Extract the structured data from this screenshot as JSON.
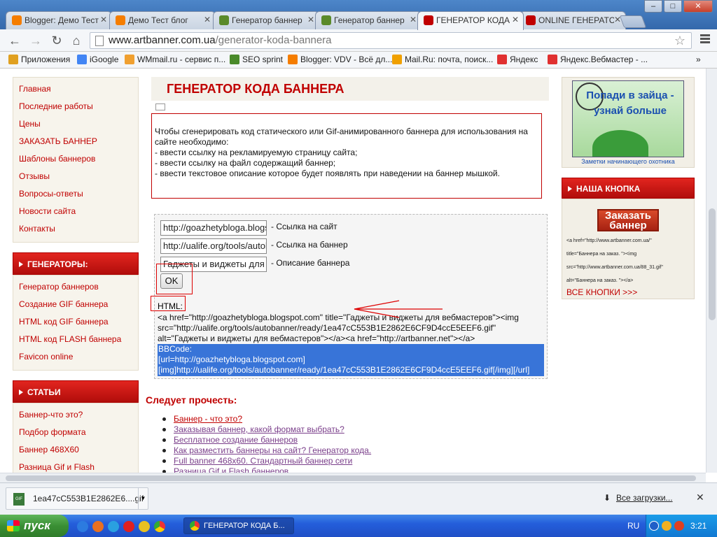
{
  "window": {
    "tabs": [
      {
        "label": "Blogger: Демо Тест",
        "icon_color": "#f57d00"
      },
      {
        "label": "Демо Тест блог",
        "icon_color": "#f57d00"
      },
      {
        "label": "Генератор баннер",
        "icon_color": "#5a8a2a"
      },
      {
        "label": "Генератор баннер",
        "icon_color": "#5a8a2a"
      },
      {
        "label": "ГЕНЕРАТОР КОДА",
        "icon_color": "#c00000",
        "active": true
      },
      {
        "label": "ONLINE ГЕНЕРАТС",
        "icon_color": "#c00000"
      }
    ],
    "buttons": {
      "minimize": "–",
      "maximize": "□",
      "close": "✕"
    }
  },
  "toolbar": {
    "url_host": "www.artbanner.com.ua",
    "url_path": "/generator-koda-bannera"
  },
  "bookmarks": [
    {
      "label": "Приложения",
      "icon_color": "#e0a020"
    },
    {
      "label": "iGoogle",
      "icon_color": "#4285f4"
    },
    {
      "label": "WMmail.ru - сервис п...",
      "icon_color": "#f0a030"
    },
    {
      "label": "SEO sprint",
      "icon_color": "#4a8a2a"
    },
    {
      "label": "Blogger: VDV - Всё дл...",
      "icon_color": "#f57d00"
    },
    {
      "label": "Mail.Ru: почта, поиск...",
      "icon_color": "#f0a000"
    },
    {
      "label": "Яндекс",
      "icon_color": "#e03030"
    },
    {
      "label": "Яндекс.Вебмастер - ...",
      "icon_color": "#e03030"
    }
  ],
  "left_menu": {
    "main": [
      "Главная",
      "Последние работы",
      "Цены",
      "ЗАКАЗАТЬ БАННЕР",
      "Шаблоны баннеров",
      "Отзывы",
      "Вопросы-ответы",
      "Новости сайта",
      "Контакты"
    ],
    "generators_title": "ГЕНЕРАТОРЫ:",
    "generators": [
      "Генератор баннеров",
      "Создание GIF баннера",
      "HTML код GIF баннера",
      "HTML код FLASH баннера",
      "Favicon online"
    ],
    "articles_title": "СТАТЬИ",
    "articles": [
      "Баннер-что это?",
      "Подбор формата",
      "Баннер 468Х60",
      "Разница Gif и Flash"
    ]
  },
  "main": {
    "title": "ГЕНЕРАТОР КОДА БАННЕРА",
    "info": [
      "Чтобы сгенерировать код статического или Gif-анимированного баннера для использования на сайте необходимо:",
      "- ввести ссылку на рекламируемую страницу сайта;",
      "- ввести ссылку на файл содержащий баннер;",
      "- ввести текстовое описание которое будет появлять при наведении на баннер мышкой."
    ],
    "fields": [
      {
        "value": "http://goazhetybloga.blogs",
        "label": "- Ссылка на сайт"
      },
      {
        "value": "http://ualife.org/tools/autol",
        "label": "- Ссылка на баннер"
      },
      {
        "value": "Гаджеты и виджеты для",
        "label": "- Описание баннера"
      }
    ],
    "ok_label": "OK",
    "html_label": "HTML:",
    "html_code": [
      "<a href=\"http://goazhetybloga.blogspot.com\" title=\"Гаджеты и виджеты для вебмастеров\"><img",
      "src=\"http://ualife.org/tools/autobanner/ready/1ea47cC553B1E2862E6CF9D4ccE5EEF6.gif\"",
      "alt=\"Гаджеты и виджеты для вебмастеров\"></a><a href=\"http://artbanner.net\"></a>"
    ],
    "bbcode": [
      "BBCode:",
      "[url=http://goazhetybloga.blogspot.com]",
      "[img]http://ualife.org/tools/autobanner/ready/1ea47cC553B1E2862E6CF9D4ccE5EEF6.gif[/img][/url]"
    ],
    "readmore_title": "Следует прочесть:",
    "readmore_links": [
      {
        "text": "Баннер - что это?",
        "visited": false
      },
      {
        "text": "Заказывая баннер, какой формат выбрать?",
        "visited": true
      },
      {
        "text": "Бесплатное создание баннеров",
        "visited": false
      },
      {
        "text": "Как разместить баннеры на сайт? Генератор кода.",
        "visited": false
      },
      {
        "text": "Full banner 468x60. Стандартный баннер сети",
        "visited": false
      },
      {
        "text": "Разница Gif и Flash баннеров",
        "visited": false
      }
    ]
  },
  "right": {
    "ad_text": "Попади в зайца - узнай больше",
    "ad_caption": "Заметки начинающего охотника",
    "button_title": "НАША КНОПКА",
    "order_button": "Заказать баннер",
    "snippet": [
      "<a href=\"http://www.artbanner.com.ua/\"",
      "title=\"Баннера на заказ. \"><img",
      "src=\"http://www.artbanner.com.ua/88_31.gif\"",
      "alt=\"Баннера на заказ. \"></a>"
    ],
    "all_buttons": "ВСЕ КНОПКИ >>>"
  },
  "downloads": {
    "file": "1ea47cC553B1E2862E6....gif",
    "file_type": "GIF",
    "all_label": "Все загрузки...",
    "close": "✕"
  },
  "taskbar": {
    "start_label": "пуск",
    "task_label": "ГЕНЕРАТОР КОДА Б...",
    "lang": "RU",
    "time": "3:21"
  }
}
